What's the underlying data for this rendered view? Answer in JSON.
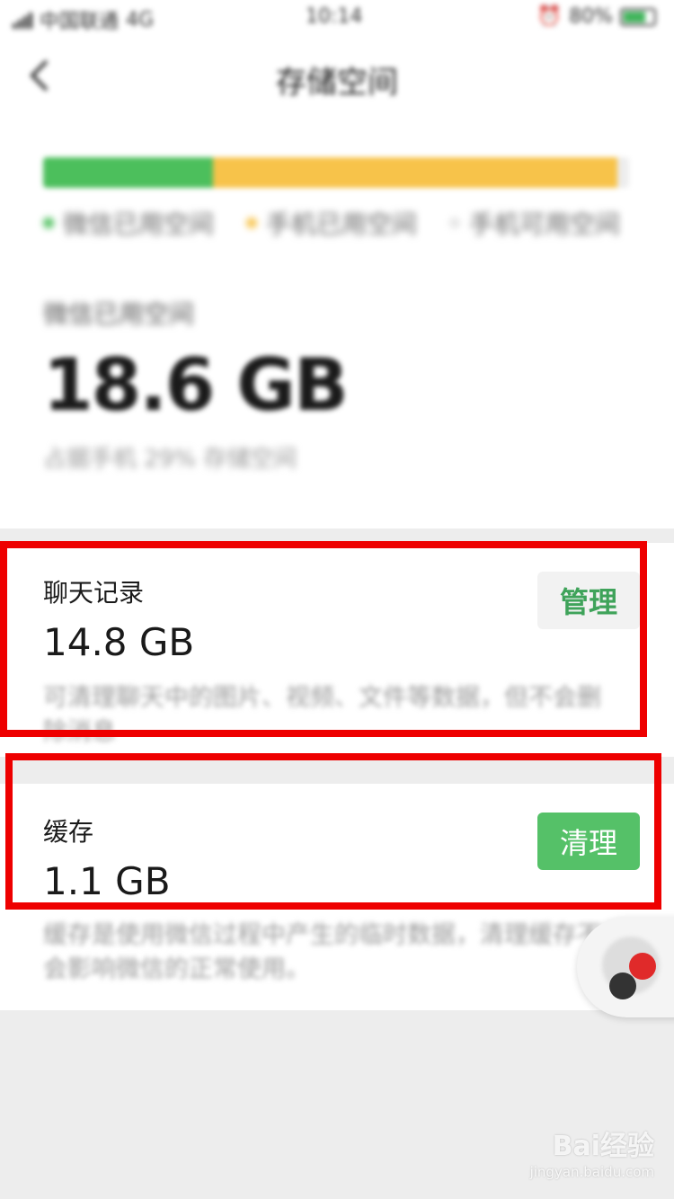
{
  "status_bar": {
    "carrier": "中国联通",
    "network": "4G",
    "time": "10:14",
    "battery": "80%"
  },
  "nav": {
    "back_icon": "chevron-left-icon",
    "title": "存储空间"
  },
  "storage_bar": {
    "wechat_fraction": 0.29,
    "phone_used_fraction": 0.69,
    "colors": {
      "wechat": "#4cbf5c",
      "phone": "#f7c34a",
      "free": "#ededed"
    }
  },
  "legend": [
    {
      "label": "微信已用空间",
      "color": "#4cbf5c"
    },
    {
      "label": "手机已用空间",
      "color": "#f7c34a"
    },
    {
      "label": "手机可用空间",
      "color": "#e4e4e4"
    }
  ],
  "wechat_usage": {
    "label": "微信已用空间",
    "size": "18.6 GB",
    "percent_text": "占据手机 29% 存储空间"
  },
  "chat_card": {
    "title": "聊天记录",
    "size": "14.8 GB",
    "description": "可清理聊天中的图片、视频、文件等数据，但不会删除消息",
    "button": "管理"
  },
  "cache_card": {
    "title": "缓存",
    "size": "1.1 GB",
    "description": "缓存是使用微信过程中产生的临时数据，清理缓存不会影响微信的正常使用。",
    "button": "清理"
  },
  "watermark": {
    "main": "Bai经验",
    "sub": "jingyan.baidu.com"
  }
}
